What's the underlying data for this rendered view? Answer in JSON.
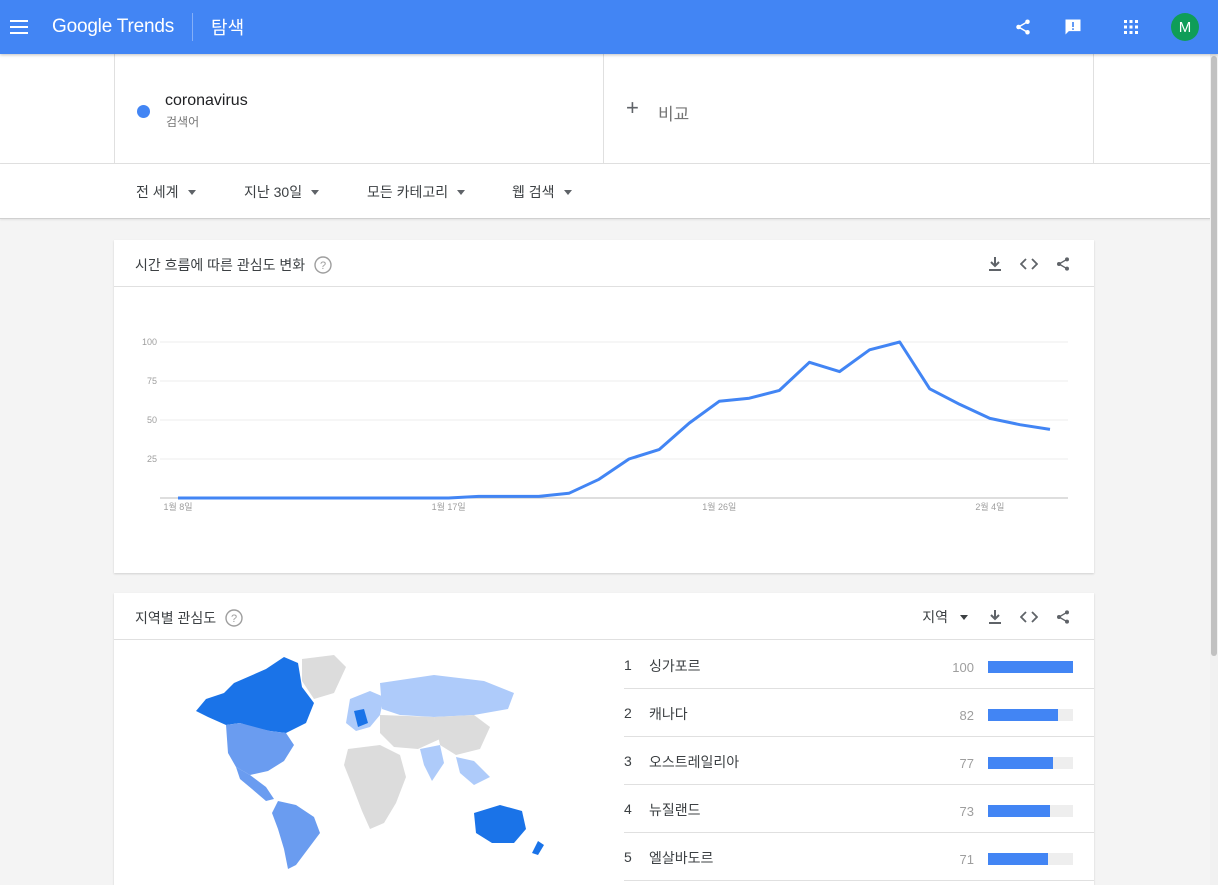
{
  "topbar": {
    "logo": "Google Trends",
    "page_name": "탐색",
    "avatar_initial": "M",
    "bar_color": "#4285f4",
    "icons": [
      "menu-icon",
      "share-icon",
      "feedback-icon",
      "apps-icon"
    ]
  },
  "term": {
    "name": "coronavirus",
    "type": "검색어",
    "color": "#4285f4"
  },
  "compare": {
    "label": "비교"
  },
  "filters": [
    "전 세계",
    "지난 30일",
    "모든 카테고리",
    "웹 검색"
  ],
  "interest_over_time": {
    "title": "시간 흐름에 따른 관심도 변화",
    "actions": [
      "download-icon",
      "embed-icon",
      "share-icon"
    ]
  },
  "chart_data": {
    "type": "line",
    "title": "",
    "xlabel": "",
    "ylabel": "",
    "ylim": [
      0,
      100
    ],
    "yticks": [
      25,
      50,
      75,
      100
    ],
    "xtick_labels": [
      "1월 8일",
      "1월 17일",
      "1월 26일",
      "2월 4일"
    ],
    "xtick_positions": [
      0,
      9,
      18,
      27
    ],
    "grid": true,
    "legend": "none",
    "series": [
      {
        "color": "#4285f4",
        "values": [
          0,
          0,
          0,
          0,
          0,
          0,
          0,
          0,
          0,
          0,
          1,
          1,
          1,
          3,
          12,
          25,
          31,
          48,
          62,
          64,
          69,
          87,
          81,
          95,
          100,
          70,
          60,
          51,
          47,
          44
        ]
      }
    ]
  },
  "interest_by_region": {
    "title": "지역별 관심도",
    "region_selector": "지역",
    "actions": [
      "download-icon",
      "embed-icon",
      "share-icon"
    ],
    "rows": [
      {
        "rank": "1",
        "name": "싱가포르",
        "value": "100",
        "fraction": 1.0
      },
      {
        "rank": "2",
        "name": "캐나다",
        "value": "82",
        "fraction": 0.82
      },
      {
        "rank": "3",
        "name": "오스트레일리아",
        "value": "77",
        "fraction": 0.77
      },
      {
        "rank": "4",
        "name": "뉴질랜드",
        "value": "73",
        "fraction": 0.73
      },
      {
        "rank": "5",
        "name": "엘살바도르",
        "value": "71",
        "fraction": 0.71
      }
    ],
    "map_icon": "world-map-icon",
    "map_colors": {
      "high": "#1a73e8",
      "mid": "#6a9cf0",
      "low": "#aecbfa",
      "none": "#dcdcdc"
    }
  }
}
